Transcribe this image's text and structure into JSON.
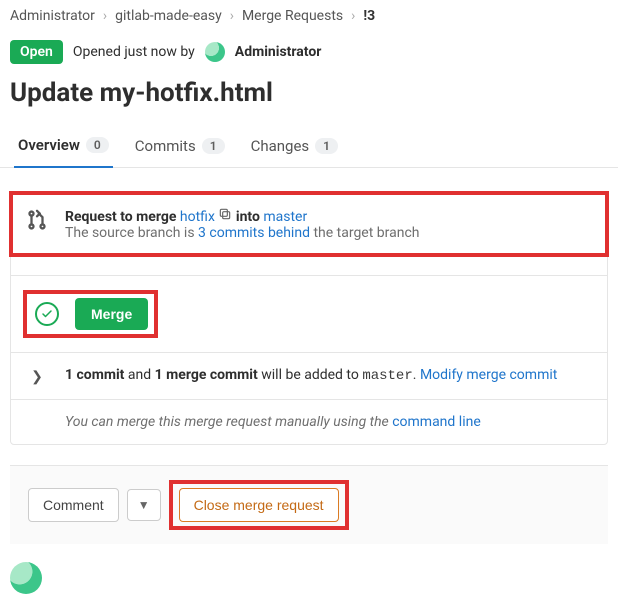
{
  "breadcrumbs": {
    "item1": "Administrator",
    "item2": "gitlab-made-easy",
    "item3": "Merge Requests",
    "item4": "!3"
  },
  "status": {
    "open_label": "Open",
    "opened_prefix": "Opened just now by",
    "author": "Administrator"
  },
  "title": "Update my-hotfix.html",
  "tabs": {
    "overview": {
      "label": "Overview",
      "count": "0"
    },
    "commits": {
      "label": "Commits",
      "count": "1"
    },
    "changes": {
      "label": "Changes",
      "count": "1"
    }
  },
  "merge_box": {
    "request_prefix": "Request to merge",
    "source_branch": "hotfix",
    "into_label": "into",
    "target_branch": "master",
    "behind_prefix": "The source branch is",
    "behind_link": "3 commits behind",
    "behind_suffix": "the target branch",
    "merge_button": "Merge",
    "commit_summary_prefix": "1 commit",
    "commit_summary_and": "and",
    "commit_summary_merge": "1 merge commit",
    "commit_summary_suffix": "will be added to",
    "commit_summary_target": "master",
    "commit_summary_dot": ".",
    "modify_link": "Modify merge commit",
    "manual_prefix": "You can merge this merge request manually using the",
    "manual_link": "command line"
  },
  "footer": {
    "comment": "Comment",
    "close": "Close merge request"
  }
}
